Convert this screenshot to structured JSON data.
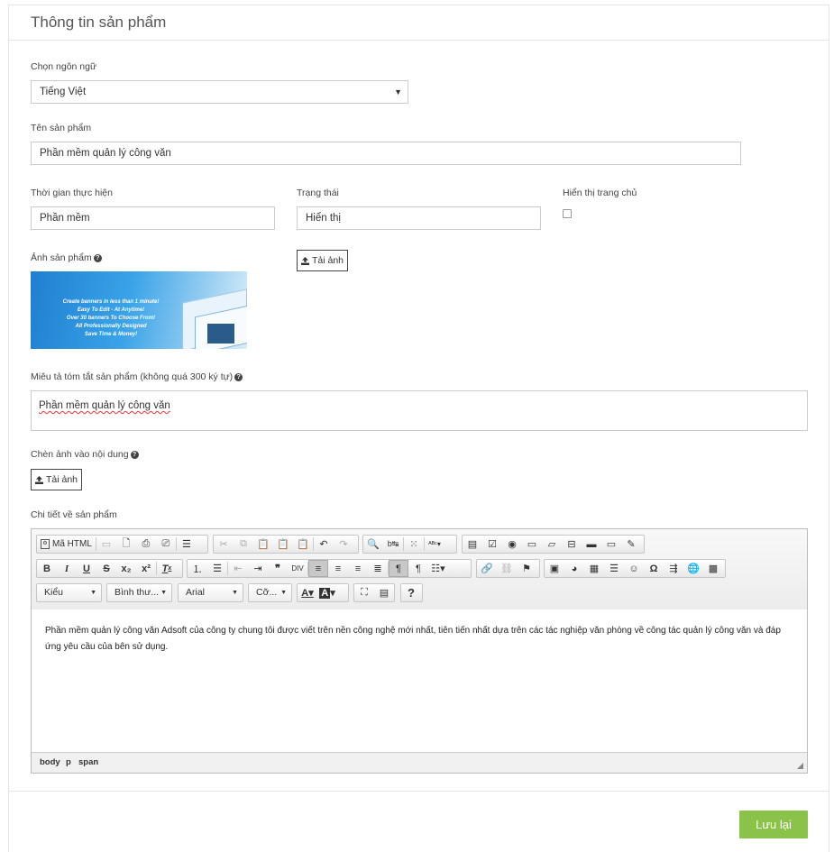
{
  "panel": {
    "title": "Thông tin sản phẩm"
  },
  "language": {
    "label": "Chọn ngôn ngữ",
    "selected": "Tiếng Việt"
  },
  "product_name": {
    "label": "Tên sản phẩm",
    "value": "Phần mềm quản lý công văn"
  },
  "duration": {
    "label": "Thời gian thực hiện",
    "value": "Phần mềm"
  },
  "status": {
    "label": "Trạng thái",
    "value": "Hiển thị"
  },
  "homepage": {
    "label": "Hiển thị trang chủ",
    "checked": false
  },
  "product_image": {
    "label": "Ảnh sản phẩm",
    "upload_label": "Tải ảnh",
    "banner_lines": [
      "Create banners in less than 1 minute!",
      "Easy To Edit - At Anytime!",
      "Over 30 banners To Choose From!",
      "All Professionally Designed",
      "Save Time & Money!"
    ]
  },
  "summary": {
    "label": "Miêu tả tóm tắt sản phẩm (không quá 300 ký tự)",
    "value": "Phần mềm quản lý công văn"
  },
  "insert_image": {
    "label": "Chèn ảnh vào nội dung",
    "upload_label": "Tải ảnh"
  },
  "details": {
    "label": "Chi tiết về sản phẩm",
    "source_label": "Mã HTML",
    "style_combo": "Kiểu",
    "format_combo": "Bình thư...",
    "font_combo": "Arial",
    "size_combo": "Cỡ...",
    "content": "Phần mềm quản lý công văn Adsoft của công ty chung tôi được viết trên nền công nghệ mới nhất, tiên tiến nhất dựa trên các tác nghiệp văn phòng về công tác quản lý công văn và đáp ứng yêu cầu của bên sử dụng.",
    "path": [
      "body",
      "p",
      "span"
    ]
  },
  "save_label": "Lưu lại",
  "colors": {
    "save": "#8bc34a",
    "border": "#cccccc"
  }
}
